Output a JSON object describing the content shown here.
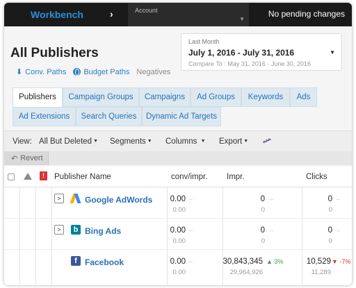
{
  "topbar": {
    "brand": "Workbench",
    "chevron": "›",
    "account_label": "Account",
    "status": "No pending changes"
  },
  "header": {
    "title": "All Publishers",
    "links": {
      "conv_paths": "Conv. Paths",
      "budget_paths": "Budget Paths",
      "negatives": "Negatives"
    }
  },
  "date": {
    "label": "Last Month",
    "range": "July 1, 2016 - July 31, 2016",
    "compare": "Compare To : May 31, 2016 - June 30, 2016"
  },
  "tabs": {
    "row1": [
      "Publishers",
      "Campaign Groups",
      "Campaigns",
      "Ad Groups",
      "Keywords",
      "Ads"
    ],
    "row2": [
      "Ad Extensions",
      "Search Queries",
      "Dynamic Ad Targets"
    ],
    "active": "Publishers"
  },
  "toolbar": {
    "view_label": "View:",
    "view_value": "All But Deleted",
    "segments": "Segments",
    "columns": "Columns",
    "export": "Export",
    "revert": "Revert"
  },
  "table": {
    "columns": {
      "alert": "!",
      "publisher": "Publisher Name",
      "conv": "conv/impr.",
      "impr": "Impr.",
      "clicks": "Clicks"
    },
    "rows": [
      {
        "name": "Google AdWords",
        "conv": "0.00",
        "conv_prev": "0.00",
        "conv_dash": "–",
        "impr": "0",
        "impr_prev": "0",
        "impr_dash": "–",
        "clicks": "0",
        "clicks_prev": "0",
        "clicks_dash": "–"
      },
      {
        "name": "Bing Ads",
        "conv": "0.00",
        "conv_prev": "0.00",
        "conv_dash": "–",
        "impr": "0",
        "impr_prev": "0",
        "impr_dash": "–",
        "clicks": "0",
        "clicks_prev": "0",
        "clicks_dash": "–"
      },
      {
        "name": "Facebook",
        "conv": "0.00",
        "conv_prev": "0.00",
        "conv_dash": "–",
        "impr": "30,843,345",
        "impr_prev": "29,964,926",
        "impr_change": "▲ 3%",
        "clicks": "10,529",
        "clicks_prev": "11,289",
        "clicks_change": "▼ -7%"
      }
    ]
  },
  "icons": {
    "bing": "b",
    "facebook": "f",
    "expand": ">"
  },
  "colors": {
    "brand_blue": "#2b8fd6",
    "link_blue": "#2a72b5",
    "up_green": "#3aa03a",
    "down_red": "#dd3333"
  }
}
